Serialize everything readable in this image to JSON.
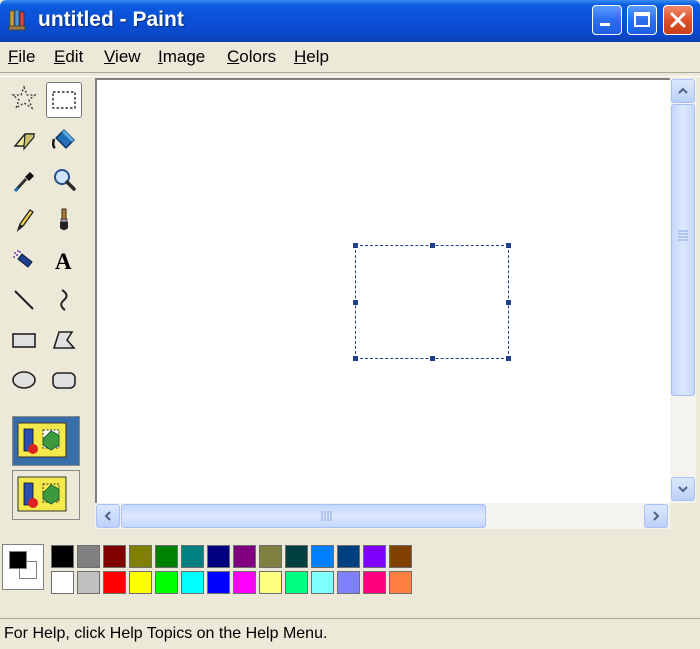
{
  "window": {
    "title": "untitled - Paint",
    "icon": "paint-icon",
    "controls": [
      "minimize-icon",
      "maximize-icon",
      "close-icon"
    ]
  },
  "menu": [
    {
      "hot": "F",
      "rest": "ile"
    },
    {
      "hot": "E",
      "rest": "dit"
    },
    {
      "hot": "V",
      "rest": "iew"
    },
    {
      "hot": "I",
      "rest": "mage"
    },
    {
      "hot": "C",
      "rest": "olors"
    },
    {
      "hot": "H",
      "rest": "elp"
    }
  ],
  "tools": [
    {
      "name": "free-form-select",
      "icon": "free-form-select-icon"
    },
    {
      "name": "select",
      "icon": "rectangle-select-icon",
      "selected": true
    },
    {
      "name": "eraser",
      "icon": "eraser-icon"
    },
    {
      "name": "fill",
      "icon": "paint-bucket-icon"
    },
    {
      "name": "pick-color",
      "icon": "eyedropper-icon"
    },
    {
      "name": "magnifier",
      "icon": "magnifier-icon"
    },
    {
      "name": "pencil",
      "icon": "pencil-icon"
    },
    {
      "name": "brush",
      "icon": "brush-icon"
    },
    {
      "name": "airbrush",
      "icon": "airbrush-icon"
    },
    {
      "name": "text",
      "icon": "text-icon",
      "glyph": "A"
    },
    {
      "name": "line",
      "icon": "line-icon"
    },
    {
      "name": "curve",
      "icon": "curve-icon"
    },
    {
      "name": "rectangle",
      "icon": "rectangle-icon"
    },
    {
      "name": "polygon",
      "icon": "polygon-icon"
    },
    {
      "name": "ellipse",
      "icon": "ellipse-icon"
    },
    {
      "name": "rounded-rectangle",
      "icon": "rounded-rectangle-icon"
    }
  ],
  "tool_options": [
    {
      "name": "opaque-selection",
      "selected": true
    },
    {
      "name": "transparent-selection",
      "selected": false
    }
  ],
  "colors": {
    "foreground": "#000000",
    "background": "#ffffff",
    "palette_top": [
      "#000000",
      "#808080",
      "#800000",
      "#808000",
      "#008000",
      "#008080",
      "#000080",
      "#800080",
      "#808040",
      "#004040",
      "#0080ff",
      "#004080",
      "#8000ff",
      "#804000"
    ],
    "palette_bottom": [
      "#ffffff",
      "#c0c0c0",
      "#ff0000",
      "#ffff00",
      "#00ff00",
      "#00ffff",
      "#0000ff",
      "#ff00ff",
      "#ffff80",
      "#00ff80",
      "#80ffff",
      "#8080ff",
      "#ff0080",
      "#ff8040"
    ]
  },
  "status": {
    "text": "For Help, click Help Topics on the Help Menu."
  },
  "accent": {
    "titlebar": "#0a50d6",
    "selection_border": "#1f3f8a",
    "scrollbar": "#c4d7fb"
  }
}
